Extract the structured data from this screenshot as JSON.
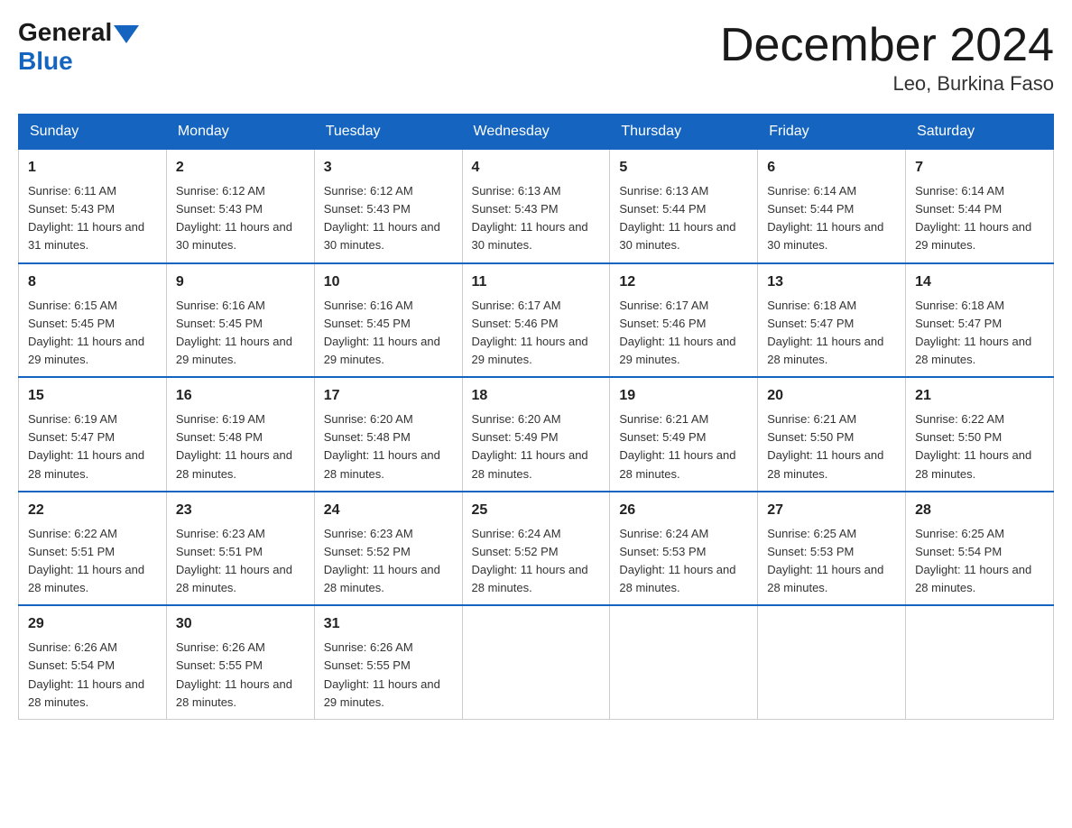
{
  "header": {
    "logo_general": "General",
    "logo_blue": "Blue",
    "month_title": "December 2024",
    "location": "Leo, Burkina Faso"
  },
  "days_of_week": [
    "Sunday",
    "Monday",
    "Tuesday",
    "Wednesday",
    "Thursday",
    "Friday",
    "Saturday"
  ],
  "weeks": [
    [
      {
        "day": "1",
        "sunrise": "6:11 AM",
        "sunset": "5:43 PM",
        "daylight": "11 hours and 31 minutes."
      },
      {
        "day": "2",
        "sunrise": "6:12 AM",
        "sunset": "5:43 PM",
        "daylight": "11 hours and 30 minutes."
      },
      {
        "day": "3",
        "sunrise": "6:12 AM",
        "sunset": "5:43 PM",
        "daylight": "11 hours and 30 minutes."
      },
      {
        "day": "4",
        "sunrise": "6:13 AM",
        "sunset": "5:43 PM",
        "daylight": "11 hours and 30 minutes."
      },
      {
        "day": "5",
        "sunrise": "6:13 AM",
        "sunset": "5:44 PM",
        "daylight": "11 hours and 30 minutes."
      },
      {
        "day": "6",
        "sunrise": "6:14 AM",
        "sunset": "5:44 PM",
        "daylight": "11 hours and 30 minutes."
      },
      {
        "day": "7",
        "sunrise": "6:14 AM",
        "sunset": "5:44 PM",
        "daylight": "11 hours and 29 minutes."
      }
    ],
    [
      {
        "day": "8",
        "sunrise": "6:15 AM",
        "sunset": "5:45 PM",
        "daylight": "11 hours and 29 minutes."
      },
      {
        "day": "9",
        "sunrise": "6:16 AM",
        "sunset": "5:45 PM",
        "daylight": "11 hours and 29 minutes."
      },
      {
        "day": "10",
        "sunrise": "6:16 AM",
        "sunset": "5:45 PM",
        "daylight": "11 hours and 29 minutes."
      },
      {
        "day": "11",
        "sunrise": "6:17 AM",
        "sunset": "5:46 PM",
        "daylight": "11 hours and 29 minutes."
      },
      {
        "day": "12",
        "sunrise": "6:17 AM",
        "sunset": "5:46 PM",
        "daylight": "11 hours and 29 minutes."
      },
      {
        "day": "13",
        "sunrise": "6:18 AM",
        "sunset": "5:47 PM",
        "daylight": "11 hours and 28 minutes."
      },
      {
        "day": "14",
        "sunrise": "6:18 AM",
        "sunset": "5:47 PM",
        "daylight": "11 hours and 28 minutes."
      }
    ],
    [
      {
        "day": "15",
        "sunrise": "6:19 AM",
        "sunset": "5:47 PM",
        "daylight": "11 hours and 28 minutes."
      },
      {
        "day": "16",
        "sunrise": "6:19 AM",
        "sunset": "5:48 PM",
        "daylight": "11 hours and 28 minutes."
      },
      {
        "day": "17",
        "sunrise": "6:20 AM",
        "sunset": "5:48 PM",
        "daylight": "11 hours and 28 minutes."
      },
      {
        "day": "18",
        "sunrise": "6:20 AM",
        "sunset": "5:49 PM",
        "daylight": "11 hours and 28 minutes."
      },
      {
        "day": "19",
        "sunrise": "6:21 AM",
        "sunset": "5:49 PM",
        "daylight": "11 hours and 28 minutes."
      },
      {
        "day": "20",
        "sunrise": "6:21 AM",
        "sunset": "5:50 PM",
        "daylight": "11 hours and 28 minutes."
      },
      {
        "day": "21",
        "sunrise": "6:22 AM",
        "sunset": "5:50 PM",
        "daylight": "11 hours and 28 minutes."
      }
    ],
    [
      {
        "day": "22",
        "sunrise": "6:22 AM",
        "sunset": "5:51 PM",
        "daylight": "11 hours and 28 minutes."
      },
      {
        "day": "23",
        "sunrise": "6:23 AM",
        "sunset": "5:51 PM",
        "daylight": "11 hours and 28 minutes."
      },
      {
        "day": "24",
        "sunrise": "6:23 AM",
        "sunset": "5:52 PM",
        "daylight": "11 hours and 28 minutes."
      },
      {
        "day": "25",
        "sunrise": "6:24 AM",
        "sunset": "5:52 PM",
        "daylight": "11 hours and 28 minutes."
      },
      {
        "day": "26",
        "sunrise": "6:24 AM",
        "sunset": "5:53 PM",
        "daylight": "11 hours and 28 minutes."
      },
      {
        "day": "27",
        "sunrise": "6:25 AM",
        "sunset": "5:53 PM",
        "daylight": "11 hours and 28 minutes."
      },
      {
        "day": "28",
        "sunrise": "6:25 AM",
        "sunset": "5:54 PM",
        "daylight": "11 hours and 28 minutes."
      }
    ],
    [
      {
        "day": "29",
        "sunrise": "6:26 AM",
        "sunset": "5:54 PM",
        "daylight": "11 hours and 28 minutes."
      },
      {
        "day": "30",
        "sunrise": "6:26 AM",
        "sunset": "5:55 PM",
        "daylight": "11 hours and 28 minutes."
      },
      {
        "day": "31",
        "sunrise": "6:26 AM",
        "sunset": "5:55 PM",
        "daylight": "11 hours and 29 minutes."
      },
      null,
      null,
      null,
      null
    ]
  ]
}
